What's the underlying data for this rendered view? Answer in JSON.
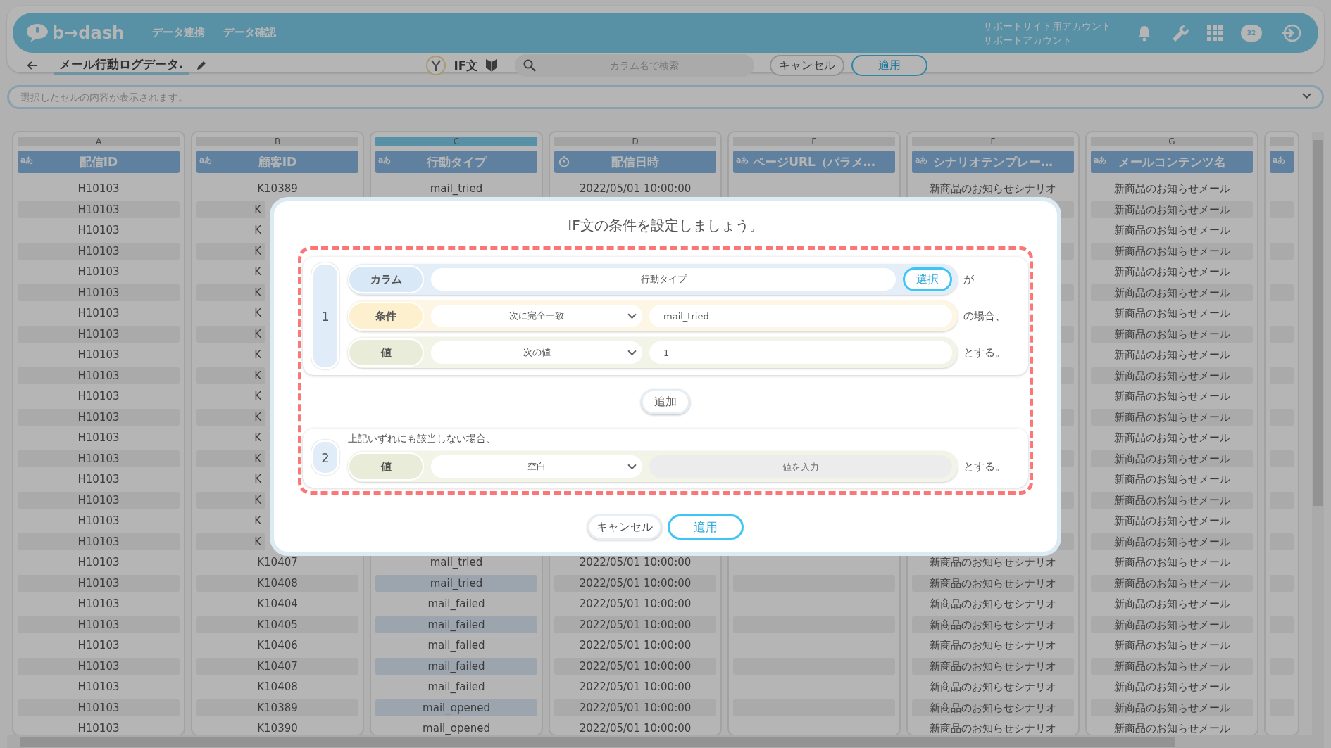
{
  "top_bar": {
    "logo": "b→dash",
    "nav": [
      "データ連携",
      "データ確認"
    ],
    "account": [
      "サポートサイト用アカウント",
      "サポートアカウント"
    ],
    "badge": "32"
  },
  "toolbar": {
    "title": "メール行動ログデータ.",
    "mode": "IF文",
    "search": {
      "placeholder": "カラム名で検索"
    },
    "buttons": [
      "キャンセル",
      "適用"
    ]
  },
  "cell_preview": {
    "placeholder": "選択したセルの内容が表示されます。"
  },
  "table": {
    "columns": [
      {
        "letter": "A",
        "name": "配信ID",
        "kind": "text",
        "type_label": "aあ",
        "selected": false
      },
      {
        "letter": "B",
        "name": "顧客ID",
        "kind": "text",
        "type_label": "aあ",
        "selected": false
      },
      {
        "letter": "C",
        "name": "行動タイプ",
        "kind": "text",
        "type_label": "aあ",
        "selected": true
      },
      {
        "letter": "D",
        "name": "配信日時",
        "kind": "datetime",
        "selected": false
      },
      {
        "letter": "E",
        "name": "ページURL（パラメ…",
        "kind": "text",
        "type_label": "aあ",
        "selected": false
      },
      {
        "letter": "F",
        "name": "シナリオテンプレー…",
        "kind": "text",
        "type_label": "aあ",
        "selected": false
      },
      {
        "letter": "G",
        "name": "メールコンテンツ名",
        "kind": "text",
        "type_label": "aあ",
        "selected": false
      },
      {
        "kind": "text",
        "type_label": "aあ",
        "selected": false
      }
    ],
    "rows": [
      {
        "cells": [
          "H10103",
          "K10389",
          "mail_tried",
          "2022/05/01 10:00:00",
          null,
          "新商品のお知らせシナリオ",
          "新商品のお知らせメール"
        ]
      },
      {
        "cells": [
          "H10103",
          "K",
          null,
          null,
          null,
          null,
          "新商品のお知らせメール"
        ],
        "clipped": true
      },
      {
        "cells": [
          "H10103",
          "K",
          null,
          null,
          null,
          null,
          "新商品のお知らせメール"
        ],
        "clipped": true
      },
      {
        "cells": [
          "H10103",
          "K",
          null,
          null,
          null,
          null,
          "新商品のお知らせメール"
        ],
        "clipped": true
      },
      {
        "cells": [
          "H10103",
          "K",
          null,
          null,
          null,
          null,
          "新商品のお知らせメール"
        ],
        "clipped": true
      },
      {
        "cells": [
          "H10103",
          "K",
          null,
          null,
          null,
          null,
          "新商品のお知らせメール"
        ],
        "clipped": true
      },
      {
        "cells": [
          "H10103",
          "K",
          null,
          null,
          null,
          null,
          "新商品のお知らせメール"
        ],
        "clipped": true
      },
      {
        "cells": [
          "H10103",
          "K",
          null,
          null,
          null,
          null,
          "新商品のお知らせメール"
        ],
        "clipped": true
      },
      {
        "cells": [
          "H10103",
          "K",
          null,
          null,
          null,
          null,
          "新商品のお知らせメール"
        ],
        "clipped": true
      },
      {
        "cells": [
          "H10103",
          "K",
          null,
          null,
          null,
          null,
          "新商品のお知らせメール"
        ],
        "clipped": true
      },
      {
        "cells": [
          "H10103",
          "K",
          null,
          null,
          null,
          null,
          "新商品のお知らせメール"
        ],
        "clipped": true
      },
      {
        "cells": [
          "H10103",
          "K",
          null,
          null,
          null,
          null,
          "新商品のお知らせメール"
        ],
        "clipped": true
      },
      {
        "cells": [
          "H10103",
          "K",
          null,
          null,
          null,
          null,
          "新商品のお知らせメール"
        ],
        "clipped": true
      },
      {
        "cells": [
          "H10103",
          "K",
          null,
          null,
          null,
          null,
          "新商品のお知らせメール"
        ],
        "clipped": true
      },
      {
        "cells": [
          "H10103",
          "K",
          null,
          null,
          null,
          null,
          "新商品のお知らせメール"
        ],
        "clipped": true
      },
      {
        "cells": [
          "H10103",
          "K",
          null,
          null,
          null,
          null,
          "新商品のお知らせメール"
        ],
        "clipped": true
      },
      {
        "cells": [
          "H10103",
          "K",
          null,
          null,
          null,
          null,
          "新商品のお知らせメール"
        ],
        "clipped": true
      },
      {
        "cells": [
          "H10103",
          "K",
          null,
          null,
          null,
          null,
          "新商品のお知らせメール"
        ],
        "clipped": true
      },
      {
        "cells": [
          "H10103",
          "K10407",
          "mail_tried",
          "2022/05/01 10:00:00",
          null,
          "新商品のお知らせシナリオ",
          "新商品のお知らせメール"
        ]
      },
      {
        "cells": [
          "H10103",
          "K10408",
          "mail_tried",
          "2022/05/01 10:00:00",
          null,
          "新商品のお知らせシナリオ",
          "新商品のお知らせメール"
        ]
      },
      {
        "cells": [
          "H10103",
          "K10404",
          "mail_failed",
          "2022/05/01 10:00:00",
          null,
          "新商品のお知らせシナリオ",
          "新商品のお知らせメール"
        ]
      },
      {
        "cells": [
          "H10103",
          "K10405",
          "mail_failed",
          "2022/05/01 10:00:00",
          null,
          "新商品のお知らせシナリオ",
          "新商品のお知らせメール"
        ]
      },
      {
        "cells": [
          "H10103",
          "K10406",
          "mail_failed",
          "2022/05/01 10:00:00",
          null,
          "新商品のお知らせシナリオ",
          "新商品のお知らせメール"
        ]
      },
      {
        "cells": [
          "H10103",
          "K10407",
          "mail_failed",
          "2022/05/01 10:00:00",
          null,
          "新商品のお知らせシナリオ",
          "新商品のお知らせメール"
        ]
      },
      {
        "cells": [
          "H10103",
          "K10408",
          "mail_failed",
          "2022/05/01 10:00:00",
          null,
          "新商品のお知らせシナリオ",
          "新商品のお知らせメール"
        ]
      },
      {
        "cells": [
          "H10103",
          "K10389",
          "mail_opened",
          "2022/05/01 10:00:00",
          null,
          "新商品のお知らせシナリオ",
          "新商品のお知らせメール"
        ]
      },
      {
        "cells": [
          "H10103",
          "K10390",
          "mail_opened",
          "2022/05/01 10:00:00",
          null,
          "新商品のお知らせシナリオ",
          "新商品のお知らせメール"
        ]
      }
    ]
  },
  "modal": {
    "title": "IF文の条件を設定しましょう。",
    "rules": [
      {
        "number": "1",
        "rows": [
          {
            "kind": "column",
            "label": "カラム",
            "value": "行動タイプ",
            "button": "選択",
            "suffix": "が"
          },
          {
            "kind": "condition",
            "label": "条件",
            "operator": "次に完全一致",
            "value": "mail_tried",
            "suffix": "の場合、"
          },
          {
            "kind": "value",
            "label": "値",
            "operator": "次の値",
            "value": "1",
            "suffix": "とする。"
          }
        ]
      }
    ],
    "add_button": "追加",
    "default": {
      "number": "2",
      "note": "上記いずれにも該当しない場合、",
      "kind": "value",
      "label": "値",
      "operator": "空白",
      "placeholder": "値を入力",
      "suffix": "とする。"
    },
    "buttons": [
      "キャンセル",
      "適用"
    ]
  }
}
